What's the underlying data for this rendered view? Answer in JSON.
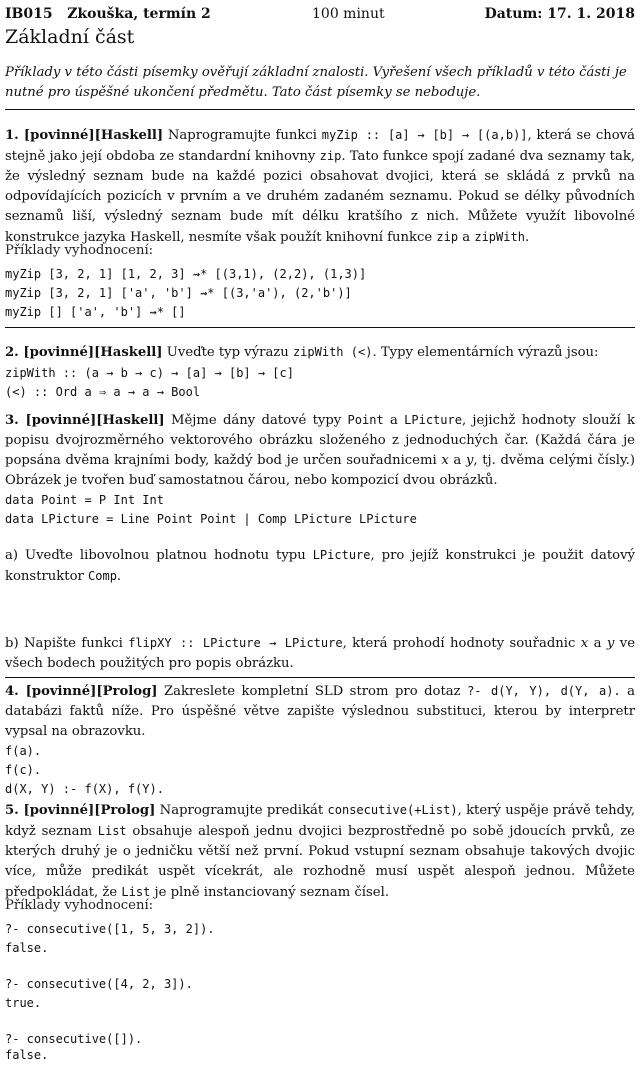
{
  "header": {
    "course": "IB015   Zkouška, termín 2",
    "duration": "100 minut",
    "date": "Datum: 17. 1. 2018"
  },
  "title": "Základní část",
  "intro": "Příklady v této části písemky ověřují základní znalosti. Vyřešení všech příkladů v této části je nutné pro úspěšné ukončení předmětu. Tato část písemky se neboduje.",
  "q1": {
    "heading": "1. [povinné][Haskell]",
    "text_a": " Naprogramujte funkci ",
    "code_a": "myZip :: [a] → [b] → [(a,b)]",
    "text_b": ", která se chová stejně jako její obdoba ze standardní knihovny ",
    "code_b": "zip",
    "text_c": ". Tato funkce spojí zadané dva seznamy tak, že výsledný seznam bude na každé pozici obsahovat dvojici, která se skládá z prvků na odpovídajících pozicích v prvním a ve druhém zadaném seznamu. Pokud se délky původních seznamů liší, výsledný seznam bude mít délku kratšího z nich. Můžete využít libovolné konstrukce jazyka Haskell, nesmíte však použít knihovní funkce ",
    "code_c": "zip",
    "text_d": " a ",
    "code_d": "zipWith",
    "text_e": ".",
    "examples_label": "Příklady vyhodnocení:",
    "examples": [
      "myZip [3, 2, 1] [1, 2, 3] ⇝* [(3,1), (2,2), (1,3)]",
      "myZip [3, 2, 1] ['a', 'b'] ⇝* [(3,'a'), (2,'b')]",
      "myZip [] ['a', 'b'] ⇝* []"
    ]
  },
  "q2": {
    "heading": "2. [povinné][Haskell]",
    "text_a": " Uveďte typ výrazu ",
    "code_a": "zipWith (<)",
    "text_b": ". Typy elementárních výrazů jsou:",
    "types": [
      "zipWith :: (a → b → c) → [a] → [b] → [c]",
      "(<) :: Ord a ⇒ a → a → Bool"
    ]
  },
  "q3": {
    "heading": "3. [povinné][Haskell]",
    "text_a": " Mějme dány datové typy ",
    "code_a": "Point",
    "text_b": " a ",
    "code_b": "LPicture",
    "text_c": ", jejichž hodnoty slouží k popisu dvojrozměrného vektorového obrázku složeného z jednoduchých čar. (Každá čára je popsána dvěma krajními body, každý bod je určen souřadnicemi ",
    "var_x": "x",
    "text_d": " a ",
    "var_y": "y",
    "text_e": ", tj. dvěma celými čísly.) Obrázek je tvořen buď samostatnou čárou, nebo kompozicí dvou obrázků.",
    "data_decls": [
      "data Point = P Int Int",
      "data LPicture = Line Point Point | Comp LPicture LPicture"
    ],
    "part_a_1": "a) Uveďte libovolnou platnou hodnotu typu ",
    "part_a_code": "LPicture",
    "part_a_2": ", pro jejíž konstrukci je použit datový konstruktor ",
    "part_a_code2": "Comp",
    "part_a_3": ".",
    "part_b_1": "b) Napište funkci ",
    "part_b_code": "flipXY :: LPicture → LPicture",
    "part_b_2": ", která prohodí hodnoty souřadnic ",
    "part_b_x": "x",
    "part_b_3": " a ",
    "part_b_y": "y",
    "part_b_4": " ve všech bodech použitých pro popis obrázku."
  },
  "q4": {
    "heading": "4. [povinné][Prolog]",
    "text_a": " Zakreslete kompletní SLD strom pro dotaz ",
    "code_a": "?- d(Y, Y), d(Y, a).",
    "text_b": " a databázi faktů níže. Pro úspěšné větve zapište výslednou substituci, kterou by interpretr vypsal na obrazovku.",
    "facts": [
      "f(a).",
      "f(c).",
      "d(X, Y) :- f(X), f(Y)."
    ]
  },
  "q5": {
    "heading": "5. [povinné][Prolog]",
    "text_a": " Naprogramujte predikát ",
    "code_a": "consecutive(+List)",
    "text_b": ", který uspěje právě tehdy, když seznam ",
    "code_b": "List",
    "text_c": " obsahuje alespoň jednu dvojici bezprostředně po sobě jdoucích prvků, ze kterých druhý je o jedničku větší než první. Pokud vstupní seznam obsahuje takových dvojic více, může predikát uspět vícekrát, ale rozhodně musí uspět alespoň jednou. Můžete předpokládat, že ",
    "code_c": "List",
    "text_d": " je plně instanciovaný seznam čísel.",
    "examples_label": "Příklady vyhodnocení:",
    "examples": [
      "?- consecutive([1, 5, 3, 2]).",
      "false.",
      "?- consecutive([4, 2, 3]).",
      "true.",
      "?- consecutive([]).",
      "false."
    ]
  }
}
